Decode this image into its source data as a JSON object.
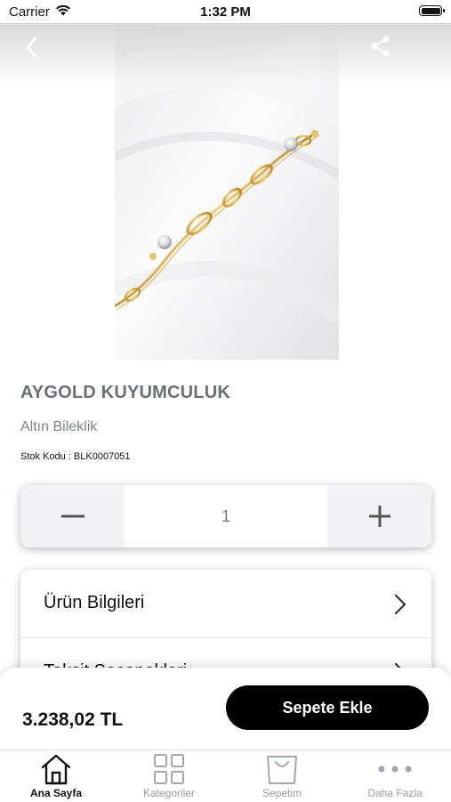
{
  "status_bar": {
    "carrier": "Carrier",
    "time": "1:32 PM"
  },
  "product": {
    "brand": "AYGOLD KUYUMCULUK",
    "category": "Altın Bileklik",
    "stock_code": "Stok Kodu : BLK0007051",
    "image": "gold-bracelet-photo"
  },
  "quantity": {
    "value": "1",
    "minus_icon": "minus-icon",
    "plus_icon": "plus-icon"
  },
  "options": [
    {
      "label": "Ürün Bilgileri"
    },
    {
      "label": "Taksit Seçenekleri"
    }
  ],
  "purchase": {
    "price": "3.238,02 TL",
    "add_to_cart": "Sepete Ekle"
  },
  "tabs": [
    {
      "label": "Ana Sayfa",
      "icon": "home-icon",
      "active": true
    },
    {
      "label": "Kategoriler",
      "icon": "grid-icon",
      "active": false
    },
    {
      "label": "Sepetim",
      "icon": "bag-icon",
      "active": false
    },
    {
      "label": "Daha Fazla",
      "icon": "more-icon",
      "active": false
    }
  ],
  "colors": {
    "accent": "#000000",
    "brand_text": "#6b6f78",
    "muted": "#9a9da3",
    "stepper_bg": "#f2f2f4"
  }
}
